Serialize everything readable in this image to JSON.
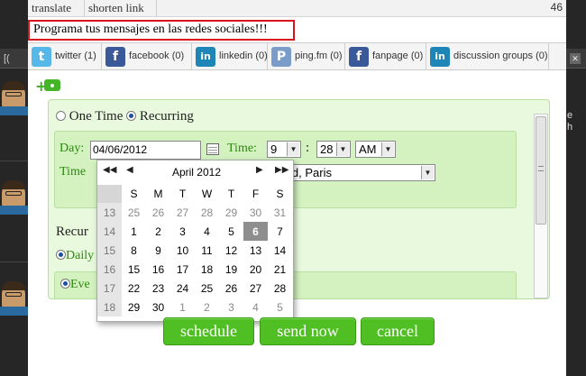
{
  "toolbar": {
    "translate_label": "translate",
    "shorten_link_label": "shorten link",
    "char_count": "46"
  },
  "message": {
    "text": "Programa tus mensajes en las redes sociales!!!"
  },
  "networks": [
    {
      "name": "twitter",
      "label": "twitter (1)",
      "icon": "twitter-icon",
      "color": "#55b8e8",
      "glyph": "t"
    },
    {
      "name": "facebook",
      "label": "facebook (0)",
      "icon": "facebook-icon",
      "color": "#3b5998",
      "glyph": "f"
    },
    {
      "name": "linkedin",
      "label": "linkedin (0)",
      "icon": "linkedin-icon",
      "color": "#1e86b7",
      "glyph": "in"
    },
    {
      "name": "pingfm",
      "label": "ping.fm (0)",
      "icon": "pingfm-icon",
      "color": "#7a9cc9",
      "glyph": "P"
    },
    {
      "name": "fanpage",
      "label": "fanpage (0)",
      "icon": "facebook-icon",
      "color": "#3b5998",
      "glyph": "f"
    },
    {
      "name": "discussion",
      "label": "discussion groups (0)",
      "icon": "linkedin-icon",
      "color": "#1e86b7",
      "glyph": "in"
    }
  ],
  "schedule": {
    "one_time_label": "One Time",
    "recurring_label": "Recurring",
    "day_label": "Day:",
    "day_value": "04/06/2012",
    "time_label": "Time:",
    "hour": "9",
    "minute": "28",
    "ampm": "AM",
    "timezone_label": "Time",
    "timezone_value": "hagen, Madrid, Paris",
    "recurrence_label": "Recur",
    "daily_label": "Daily",
    "every_label": "Eve"
  },
  "datepicker": {
    "prev_year": "◀◀",
    "prev_month": "◀",
    "next_month": "▶",
    "next_year": "▶▶",
    "title": "April 2012",
    "weekdays": [
      "S",
      "M",
      "T",
      "W",
      "T",
      "F",
      "S"
    ],
    "weeks": [
      {
        "wk": "13",
        "days": [
          "25",
          "26",
          "27",
          "28",
          "29",
          "30",
          "31"
        ],
        "other": [
          true,
          true,
          true,
          true,
          true,
          true,
          true
        ]
      },
      {
        "wk": "14",
        "days": [
          "1",
          "2",
          "3",
          "4",
          "5",
          "6",
          "7"
        ],
        "other": [
          false,
          false,
          false,
          false,
          false,
          false,
          false
        ]
      },
      {
        "wk": "15",
        "days": [
          "8",
          "9",
          "10",
          "11",
          "12",
          "13",
          "14"
        ],
        "other": [
          false,
          false,
          false,
          false,
          false,
          false,
          false
        ]
      },
      {
        "wk": "16",
        "days": [
          "15",
          "16",
          "17",
          "18",
          "19",
          "20",
          "21"
        ],
        "other": [
          false,
          false,
          false,
          false,
          false,
          false,
          false
        ]
      },
      {
        "wk": "17",
        "days": [
          "22",
          "23",
          "24",
          "25",
          "26",
          "27",
          "28"
        ],
        "other": [
          false,
          false,
          false,
          false,
          false,
          false,
          false
        ]
      },
      {
        "wk": "18",
        "days": [
          "29",
          "30",
          "1",
          "2",
          "3",
          "4",
          "5"
        ],
        "other": [
          false,
          false,
          true,
          true,
          true,
          true,
          true
        ]
      }
    ],
    "selected": "6"
  },
  "buttons": {
    "schedule": "schedule",
    "send_now": "send now",
    "cancel": "cancel"
  },
  "background": {
    "tab_text": "[(",
    "right_text_1": "e",
    "right_text_2": "h"
  }
}
